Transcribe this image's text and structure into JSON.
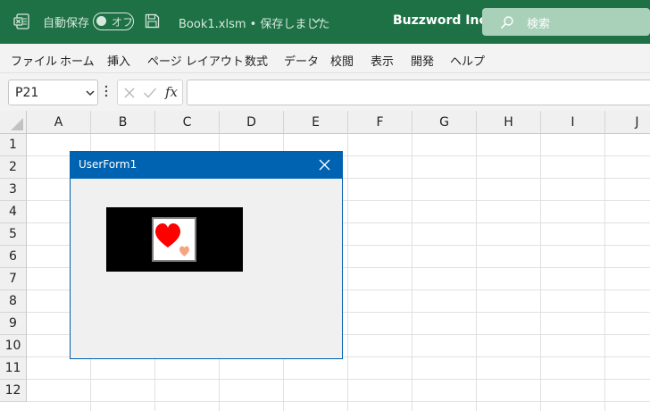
{
  "titlebar": {
    "autosave_label": "自動保存",
    "autosave_state": "オフ",
    "filename": "Book1.xlsm • 保存しました",
    "brand": "Buzzword Inc.",
    "search_placeholder": "検索",
    "bg_color": "#1e7145"
  },
  "ribbon": {
    "tabs": [
      "ファイル",
      "ホーム",
      "挿入",
      "ページ レイアウト",
      "数式",
      "データ",
      "校閲",
      "表示",
      "開発",
      "ヘルプ"
    ]
  },
  "formula_bar": {
    "name_box": "P21",
    "fx_label": "fx",
    "formula": ""
  },
  "sheet": {
    "columns": [
      "A",
      "B",
      "C",
      "D",
      "E",
      "F",
      "G",
      "H",
      "I",
      "J"
    ],
    "rows": [
      "1",
      "2",
      "3",
      "4",
      "5",
      "6",
      "7",
      "8",
      "9",
      "10",
      "11",
      "12"
    ]
  },
  "userform": {
    "title": "UserForm1",
    "title_color": "#0063b1",
    "image_background": "#000000",
    "picture_icons": [
      "big-red-heart-icon",
      "small-peach-heart-icon"
    ],
    "heart_colors": [
      "#ff0000",
      "#f4a582"
    ]
  }
}
